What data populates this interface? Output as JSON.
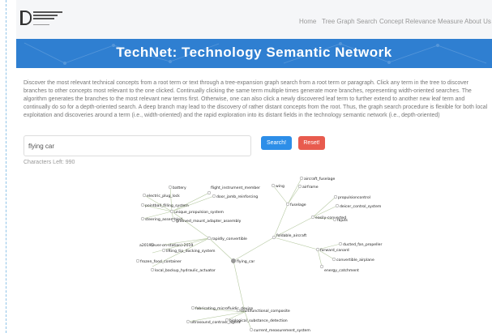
{
  "nav": {
    "links": [
      "Home",
      "Tree Graph Search",
      "Concept Relevance Measure",
      "About Us"
    ]
  },
  "hero": {
    "title": "TechNet: Technology Semantic Network"
  },
  "description": "Discover the most relevant technical concepts from a root term or text through a tree-expansion graph search from a root term or paragraph. Click any term in the tree to discover branches to other concepts most relevant to the one clicked. Continually clicking the same term multiple times generate more branches, representing width-oriented searches. The algorithm generates the branches to the most relevant new terms first. Otherwise, one can also click a newly discovered leaf term to further extend to another new leaf term and continually do so for a depth-oriented search. A deep branch may lead to the discovery of rather distant concepts from the root. Thus, the graph search procedure is flexible for both local exploitation and discoveries around a term (i.e., width-oriented) and the rapid exploration into its distant fields in the technology semantic network (i.e., depth-oriented)",
  "search": {
    "value": "flying car",
    "search_label": "Search!",
    "reset_label": "Reset!",
    "chars_left": "Characters Left: 990"
  },
  "colors": {
    "hero_bg": "#2f7fd1",
    "search_btn": "#2d8ee8",
    "reset_btn": "#e85b4e",
    "edge": "#b6c9a2"
  },
  "graph": {
    "nodes": [
      {
        "id": "flying_car",
        "label": "flying_car",
        "root": true
      },
      {
        "id": "rapidly_convertible",
        "label": "rapidly_convertible"
      },
      {
        "id": "unique_propulsion_system",
        "label": "unique_propulsion_system"
      },
      {
        "id": "battery",
        "label": "battery"
      },
      {
        "id": "flight_instrument_member",
        "label": "flight_instrument_member"
      },
      {
        "id": "door_jamb_reinforcing",
        "label": "door_jamb_reinforcing"
      },
      {
        "id": "electric_plug_lock",
        "label": "electric_plug_lock"
      },
      {
        "id": "pointball_filling_system",
        "label": "pointball_filling_system"
      },
      {
        "id": "steering_assembled",
        "label": "steering_assembled"
      },
      {
        "id": "grooved_mount_adapter_assembly",
        "label": "grooved_mount_adapter_assembly"
      },
      {
        "id": "a2019",
        "label": "a2019(ever-on-station)-2019"
      },
      {
        "id": "lifting_tip_docking_system",
        "label": "lifting_tip_docking_system"
      },
      {
        "id": "frozen_food_container",
        "label": "frozen_food_container"
      },
      {
        "id": "local_backup_hydraulic_actuator",
        "label": "local_backup_hydraulic_actuator"
      },
      {
        "id": "foldable_aircraft",
        "label": "foldable_aircraft"
      },
      {
        "id": "fuselage",
        "label": "fuselage"
      },
      {
        "id": "wing",
        "label": "wing"
      },
      {
        "id": "aircraft_fuselage",
        "label": "aircraft_fuselage"
      },
      {
        "id": "airframe",
        "label": "airframe"
      },
      {
        "id": "propulsioncontrol",
        "label": "propulsioncontrol"
      },
      {
        "id": "deicer_control_system",
        "label": "deicer_control_system"
      },
      {
        "id": "easily_converted",
        "label": "easily-converted"
      },
      {
        "id": "fbjuts",
        "label": "fbjuts"
      },
      {
        "id": "forward_canard",
        "label": "forward_canard"
      },
      {
        "id": "ducted_fan_propeller",
        "label": "ducted_fan_propeller"
      },
      {
        "id": "convertible_airplane",
        "label": "convertible_airplane"
      },
      {
        "id": "energy_catchment",
        "label": "energy_catchment"
      },
      {
        "id": "fabricating_microfluidic_device",
        "label": "fabricating_microfluidic_device"
      },
      {
        "id": "multifunctional_composite",
        "label": "multifunctional_composite"
      },
      {
        "id": "ultrasound_contrast_agent",
        "label": "ultrasound_contrast_agent"
      },
      {
        "id": "biological_substance_detection",
        "label": "biological_substance_detection"
      },
      {
        "id": "current_measurement_system",
        "label": "current_measurement_system"
      }
    ]
  }
}
